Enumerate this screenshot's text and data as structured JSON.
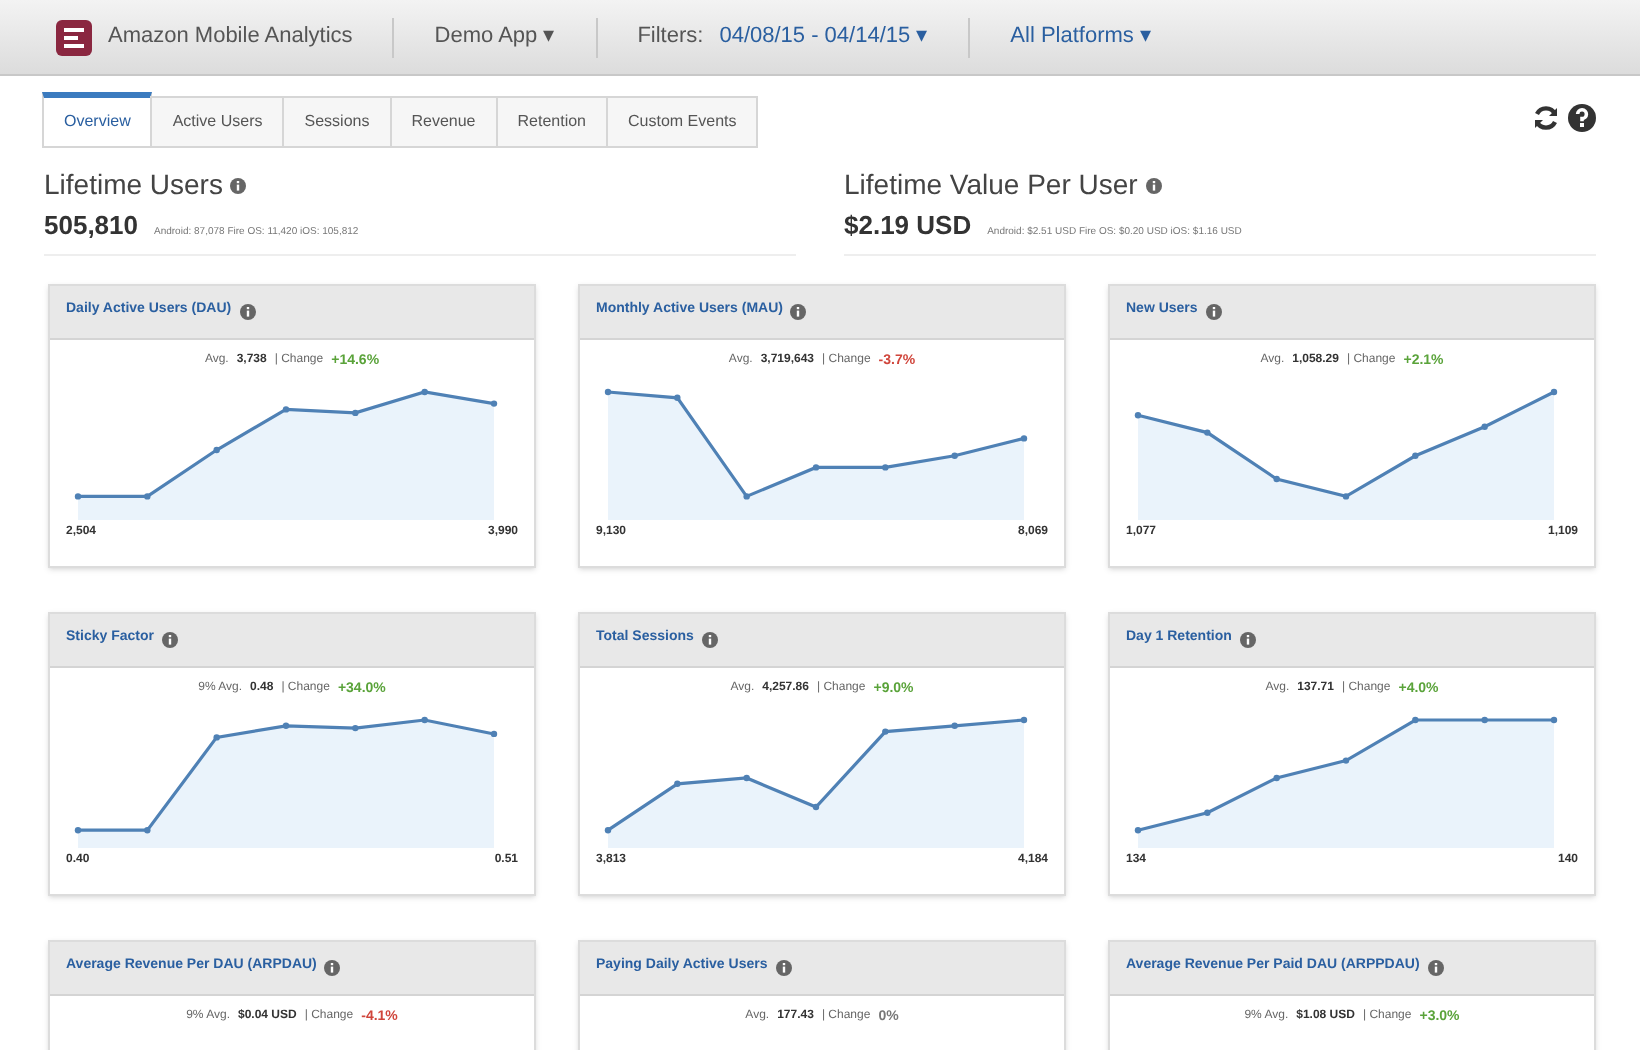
{
  "header": {
    "app_name": "Amazon Mobile Analytics",
    "app_menu": "Demo App ▾",
    "filters_label": "Filters:",
    "date_filter": "04/08/15 - 04/14/15 ▾",
    "platform_filter": "All Platforms ▾"
  },
  "tabs": [
    {
      "label": "Overview",
      "selected": true
    },
    {
      "label": "Active Users",
      "selected": false
    },
    {
      "label": "Sessions",
      "selected": false
    },
    {
      "label": "Revenue",
      "selected": false
    },
    {
      "label": "Retention",
      "selected": false
    },
    {
      "label": "Custom Events",
      "selected": false
    }
  ],
  "summaries": [
    {
      "title": "Lifetime Users",
      "value": "505,810",
      "breakdown": "Android: 87,078  Fire OS: 11,420  iOS: 105,812"
    },
    {
      "title": "Lifetime Value Per User",
      "value": "$2.19 USD",
      "breakdown": "Android: $2.51 USD  Fire OS: $0.20 USD  iOS: $1.16 USD"
    }
  ],
  "cards": [
    {
      "title": "Daily Active Users (DAU)",
      "avg_prefix": "Avg.",
      "avg": "3,738",
      "change_label": "| Change",
      "change": "+14.6%",
      "color": "#5aa33a",
      "start": "2,504",
      "end": "3,990"
    },
    {
      "title": "Monthly Active Users (MAU)",
      "avg_prefix": "Avg.",
      "avg": "3,719,643",
      "change_label": "| Change",
      "change": "-3.7%",
      "color": "#d0453b",
      "start": "9,130",
      "end": "8,069"
    },
    {
      "title": "New Users",
      "avg_prefix": "Avg.",
      "avg": "1,058.29",
      "change_label": "| Change",
      "change": "+2.1%",
      "color": "#5aa33a",
      "start": "1,077",
      "end": "1,109"
    },
    {
      "title": "Sticky Factor",
      "avg_prefix": "9% Avg.",
      "avg": "0.48",
      "change_label": "| Change",
      "change": "+34.0%",
      "color": "#5aa33a",
      "start": "0.40",
      "end": "0.51"
    },
    {
      "title": "Total Sessions",
      "avg_prefix": "Avg.",
      "avg": "4,257.86",
      "change_label": "| Change",
      "change": "+9.0%",
      "color": "#5aa33a",
      "start": "3,813",
      "end": "4,184"
    },
    {
      "title": "Day 1 Retention",
      "avg_prefix": "Avg.",
      "avg": "137.71",
      "change_label": "| Change",
      "change": "+4.0%",
      "color": "#5aa33a",
      "start": "134",
      "end": "140"
    },
    {
      "title": "Average Revenue Per DAU (ARPDAU)",
      "avg_prefix": "9% Avg.",
      "avg": "$0.04 USD",
      "change_label": "| Change",
      "change": "-4.1%",
      "color": "#d0453b"
    },
    {
      "title": "Paying Daily Active Users",
      "avg_prefix": "Avg.",
      "avg": "177.43",
      "change_label": "| Change",
      "change": "0%",
      "color": "#777777"
    },
    {
      "title": "Average Revenue Per Paid DAU (ARPPDAU)",
      "avg_prefix": "9% Avg.",
      "avg": "$1.08 USD",
      "change_label": "| Change",
      "change": "+3.0%",
      "color": "#5aa33a"
    }
  ]
}
